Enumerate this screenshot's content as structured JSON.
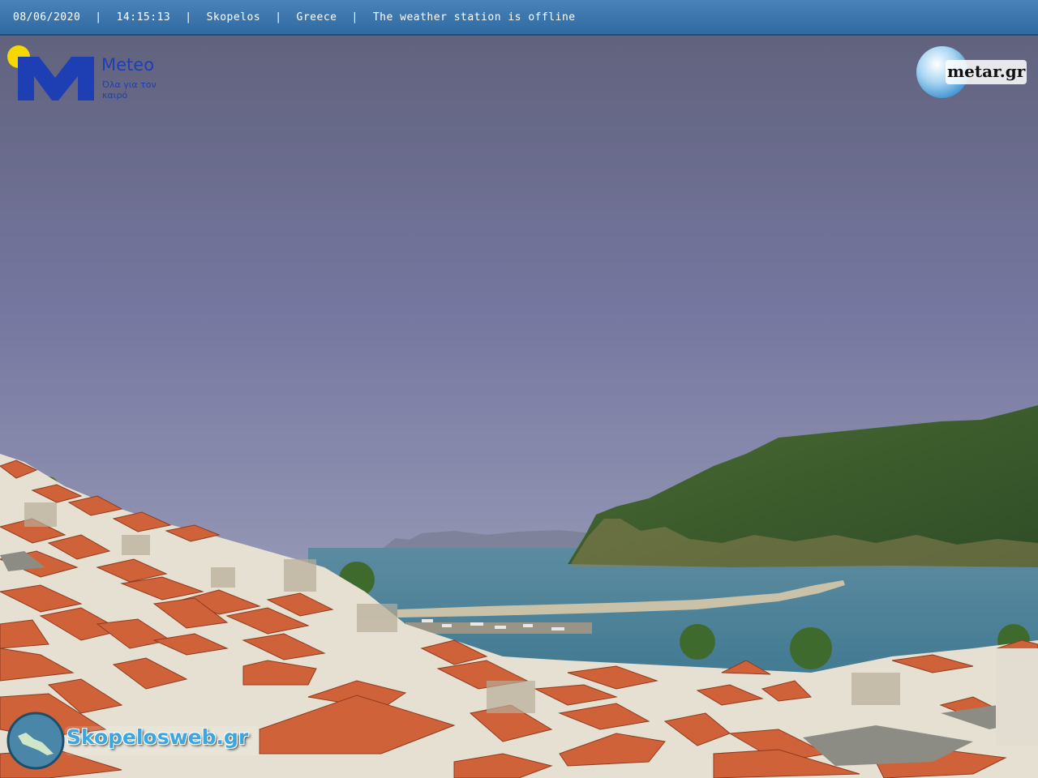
{
  "status_bar": {
    "date": "08/06/2020",
    "time": "14:15:13",
    "location": "Skopelos",
    "country": "Greece",
    "message": "The weather station is offline",
    "separator": "|"
  },
  "logos": {
    "meteo_name": "Meteo",
    "meteo_tagline": "Όλα για τον καιρό",
    "metar_name": "metar.gr",
    "site_name": "Skopelosweb.gr"
  },
  "colors": {
    "sky_top": "#62647f",
    "sky_horizon": "#8c8fb0",
    "sea": "#4a7f96",
    "roof": "#d0623a",
    "hill": "#3c5c2c",
    "bar": "#3a74ad"
  }
}
